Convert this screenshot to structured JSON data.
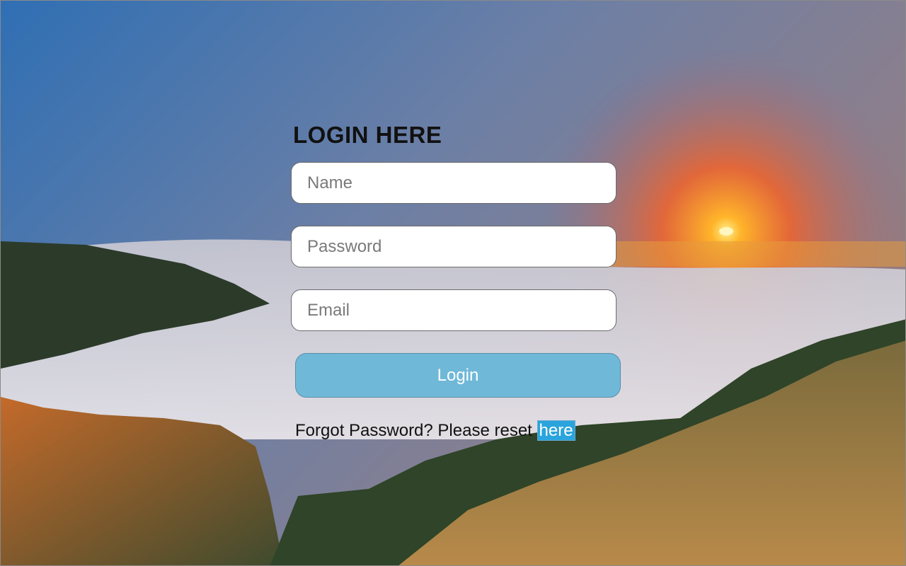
{
  "login_form": {
    "title": "LOGIN HERE",
    "name_placeholder": "Name",
    "password_placeholder": "Password",
    "email_placeholder": "Email",
    "login_label": "Login",
    "forgot_text": "Forgot Password? Please reset ",
    "reset_link_label": "here"
  },
  "colors": {
    "login_button": "#6fb8d8",
    "reset_link_highlight": "#2aa4dc",
    "title_text": "#111111"
  }
}
